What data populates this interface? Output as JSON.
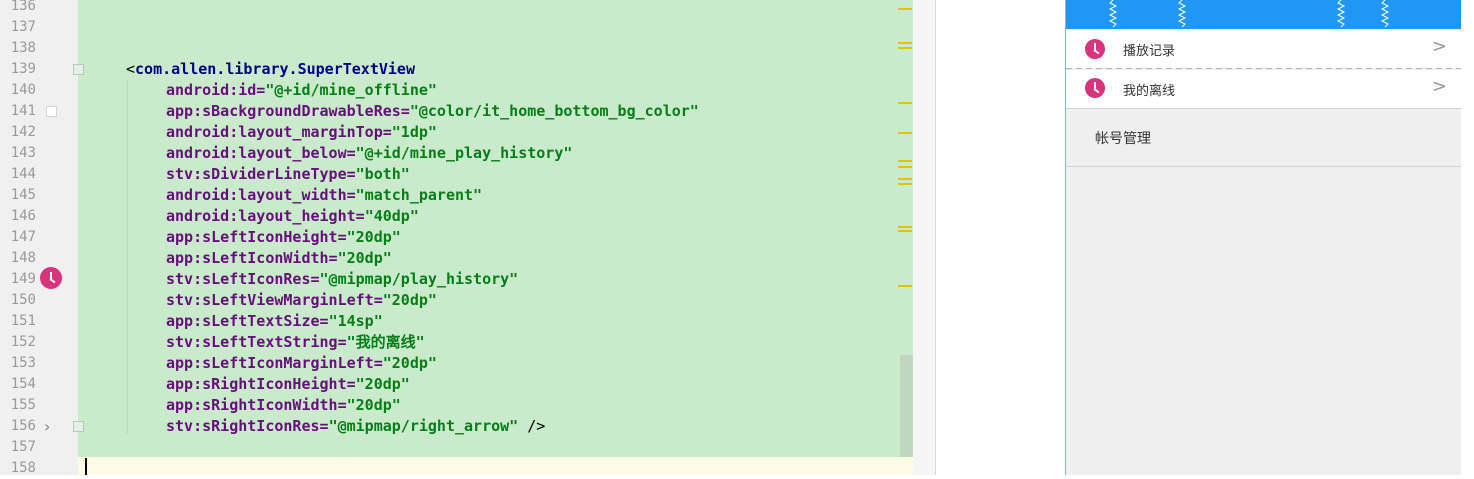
{
  "editor": {
    "line_numbers": [
      "136",
      "137",
      "138",
      "139",
      "140",
      "141",
      "142",
      "143",
      "144",
      "145",
      "146",
      "147",
      "148",
      "149",
      "150",
      "151",
      "152",
      "153",
      "154",
      "155",
      "156",
      "157",
      "158"
    ],
    "code_lines": [
      {
        "line": "139",
        "parts": [
          {
            "t": "plain",
            "s": "<"
          },
          {
            "t": "tag",
            "s": "com.allen.library.SuperTextView"
          }
        ]
      },
      {
        "line": "140",
        "parts": [
          {
            "t": "ns",
            "s": "android"
          },
          {
            "t": "attr",
            "s": ":id="
          },
          {
            "t": "val",
            "s": "\"@+id/mine_offline\""
          }
        ]
      },
      {
        "line": "141",
        "parts": [
          {
            "t": "ns",
            "s": "app"
          },
          {
            "t": "attr",
            "s": ":sBackgroundDrawableRes="
          },
          {
            "t": "val",
            "s": "\"@color/it_home_bottom_bg_color\""
          }
        ]
      },
      {
        "line": "142",
        "parts": [
          {
            "t": "ns",
            "s": "android"
          },
          {
            "t": "attr",
            "s": ":layout_marginTop="
          },
          {
            "t": "val",
            "s": "\"1dp\""
          }
        ]
      },
      {
        "line": "143",
        "parts": [
          {
            "t": "ns",
            "s": "android"
          },
          {
            "t": "attr",
            "s": ":layout_below="
          },
          {
            "t": "val",
            "s": "\"@+id/mine_play_history\""
          }
        ]
      },
      {
        "line": "144",
        "parts": [
          {
            "t": "ns",
            "s": "stv"
          },
          {
            "t": "attr",
            "s": ":sDividerLineType="
          },
          {
            "t": "val",
            "s": "\"both\""
          }
        ]
      },
      {
        "line": "145",
        "parts": [
          {
            "t": "ns",
            "s": "android"
          },
          {
            "t": "attr",
            "s": ":layout_width="
          },
          {
            "t": "val",
            "s": "\"match_parent\""
          }
        ]
      },
      {
        "line": "146",
        "parts": [
          {
            "t": "ns",
            "s": "android"
          },
          {
            "t": "attr",
            "s": ":layout_height="
          },
          {
            "t": "val",
            "s": "\"40dp\""
          }
        ]
      },
      {
        "line": "147",
        "parts": [
          {
            "t": "ns",
            "s": "app"
          },
          {
            "t": "attr",
            "s": ":sLeftIconHeight="
          },
          {
            "t": "val",
            "s": "\"20dp\""
          }
        ]
      },
      {
        "line": "148",
        "parts": [
          {
            "t": "ns",
            "s": "app"
          },
          {
            "t": "attr",
            "s": ":sLeftIconWidth="
          },
          {
            "t": "val",
            "s": "\"20dp\""
          }
        ]
      },
      {
        "line": "149",
        "parts": [
          {
            "t": "ns",
            "s": "stv"
          },
          {
            "t": "attr",
            "s": ":sLeftIconRes="
          },
          {
            "t": "val",
            "s": "\"@mipmap/play_history\""
          }
        ]
      },
      {
        "line": "150",
        "parts": [
          {
            "t": "ns",
            "s": "stv"
          },
          {
            "t": "attr",
            "s": ":sLeftViewMarginLeft="
          },
          {
            "t": "val",
            "s": "\"20dp\""
          }
        ]
      },
      {
        "line": "151",
        "parts": [
          {
            "t": "ns",
            "s": "app"
          },
          {
            "t": "attr",
            "s": ":sLeftTextSize="
          },
          {
            "t": "val",
            "s": "\"14sp\""
          }
        ]
      },
      {
        "line": "152",
        "parts": [
          {
            "t": "ns",
            "s": "stv"
          },
          {
            "t": "attr",
            "s": ":sLeftTextString="
          },
          {
            "t": "val",
            "s": "\"我的离线\""
          }
        ]
      },
      {
        "line": "153",
        "parts": [
          {
            "t": "ns",
            "s": "app"
          },
          {
            "t": "attr",
            "s": ":sLeftIconMarginLeft="
          },
          {
            "t": "val",
            "s": "\"20dp\""
          }
        ]
      },
      {
        "line": "154",
        "parts": [
          {
            "t": "ns",
            "s": "app"
          },
          {
            "t": "attr",
            "s": ":sRightIconHeight="
          },
          {
            "t": "val",
            "s": "\"20dp\""
          }
        ]
      },
      {
        "line": "155",
        "parts": [
          {
            "t": "ns",
            "s": "app"
          },
          {
            "t": "attr",
            "s": ":sRightIconWidth="
          },
          {
            "t": "val",
            "s": "\"20dp\""
          }
        ]
      },
      {
        "line": "156",
        "parts": [
          {
            "t": "ns",
            "s": "stv"
          },
          {
            "t": "attr",
            "s": ":sRightIconRes="
          },
          {
            "t": "val",
            "s": "\"@mipmap/right_arrow\""
          },
          {
            "t": "plain",
            "s": " />"
          }
        ]
      }
    ],
    "gutter_icon": "clock-icon",
    "highlight_color": "#c9ebcb"
  },
  "preview": {
    "header_color": "#2196f3",
    "rows": [
      {
        "label": "播放记录",
        "icon": "clock-icon",
        "arrow": "chevron-right-icon"
      },
      {
        "label": "我的离线",
        "icon": "clock-icon",
        "arrow": "chevron-right-icon"
      }
    ],
    "account_label": "帐号管理",
    "accent_color": "#d8337d"
  }
}
